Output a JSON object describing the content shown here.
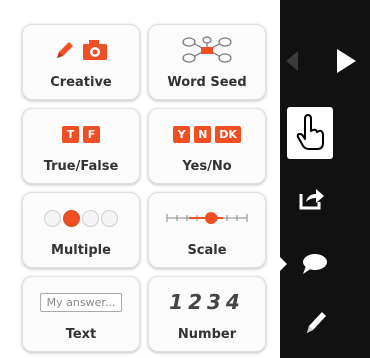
{
  "question_types": {
    "creative": {
      "label": "Creative"
    },
    "word_seed": {
      "label": "Word Seed"
    },
    "true_false": {
      "label": "True/False",
      "chips": [
        "T",
        "F"
      ]
    },
    "yes_no": {
      "label": "Yes/No",
      "chips": [
        "Y",
        "N",
        "DK"
      ]
    },
    "multiple": {
      "label": "Multiple",
      "selected_index": 1,
      "count": 4
    },
    "scale": {
      "label": "Scale",
      "level": 0.55
    },
    "text": {
      "label": "Text",
      "placeholder": "My answer..."
    },
    "number": {
      "label": "Number",
      "sample": "1234"
    }
  },
  "colors": {
    "accent": "#f04e23",
    "sidebar": "#111111",
    "panel": "#ffffff"
  },
  "sidebar_icons": [
    "back-arrow-icon",
    "play-icon",
    "hand-pointer-icon",
    "share-icon",
    "comment-icon",
    "pencil-icon"
  ]
}
